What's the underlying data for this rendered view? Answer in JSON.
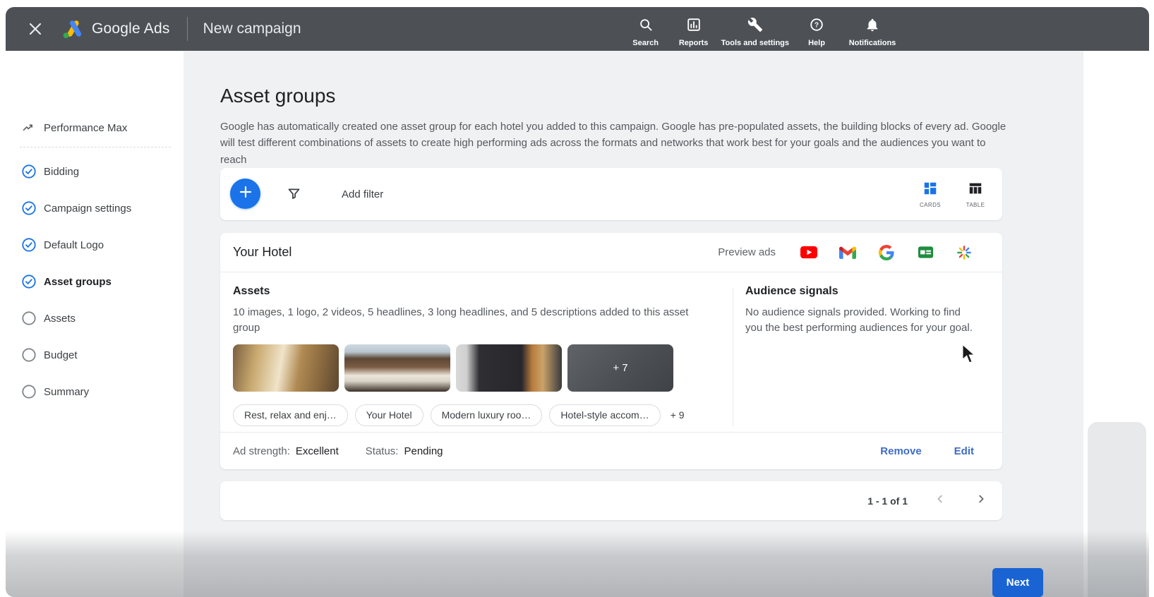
{
  "topbar": {
    "brand": "Google Ads",
    "page_title": "New campaign",
    "actions": [
      {
        "label": "Search",
        "icon": "search-icon"
      },
      {
        "label": "Reports",
        "icon": "reports-icon"
      },
      {
        "label": "Tools and settings",
        "icon": "tools-icon"
      },
      {
        "label": "Help",
        "icon": "help-icon"
      },
      {
        "label": "Notifications",
        "icon": "notifications-icon"
      }
    ]
  },
  "sidebar": {
    "header": {
      "label": "Performance Max",
      "icon": "performance-max-icon"
    },
    "items": [
      {
        "label": "Bidding",
        "state": "completed"
      },
      {
        "label": "Campaign settings",
        "state": "completed"
      },
      {
        "label": "Default Logo",
        "state": "completed"
      },
      {
        "label": "Asset groups",
        "state": "completed",
        "active": true
      },
      {
        "label": "Assets",
        "state": "pending"
      },
      {
        "label": "Budget",
        "state": "pending"
      },
      {
        "label": "Summary",
        "state": "pending"
      }
    ]
  },
  "main": {
    "title": "Asset groups",
    "description": "Google has automatically created one asset group for each hotel you added to this campaign. Google has pre-populated assets, the building blocks of every ad. Google will test different combinations of assets to create high performing ads across the formats and networks that work best for your goals and the audiences you want to reach",
    "toolbar": {
      "add_filter_label": "Add filter",
      "cards_label": "CARDS",
      "table_label": "TABLE"
    },
    "asset_group": {
      "name": "Your Hotel",
      "preview_ads_label": "Preview ads",
      "preview_channels": [
        "youtube-icon",
        "gmail-icon",
        "google-icon",
        "display-icon",
        "discover-icon"
      ],
      "assets": {
        "heading": "Assets",
        "summary": "10 images, 1 logo, 2 videos, 5 headlines, 3 long headlines, and 5 descriptions added to this asset group",
        "thumbnails": [
          "hotel-lobby",
          "hotel-room",
          "chef-cooking",
          "more-images"
        ],
        "more_images_label": "+ 7",
        "chips": [
          "Rest, relax and enj…",
          "Your Hotel",
          "Modern luxury roo…",
          "Hotel-style accom…"
        ],
        "more_chips_label": "+ 9"
      },
      "audience_signals": {
        "heading": "Audience signals",
        "text": "No audience signals provided. Working to find you the best performing audiences for your goal."
      },
      "footer": {
        "ad_strength_label": "Ad strength:",
        "ad_strength_value": "Excellent",
        "status_label": "Status:",
        "status_value": "Pending",
        "remove_label": "Remove",
        "edit_label": "Edit"
      }
    },
    "pagination": {
      "range_label": "1 - 1 of 1"
    },
    "next_button_label": "Next"
  },
  "colors": {
    "topbar_bg": "#4d5156",
    "accent_blue": "#1a73e8",
    "link_blue": "#3f6cc2",
    "next_button_bg": "#1a63d2",
    "completed_step": "#1a73e8",
    "text_primary": "#202124",
    "text_secondary": "#5f6368",
    "content_bg": "#f0f1f3"
  }
}
